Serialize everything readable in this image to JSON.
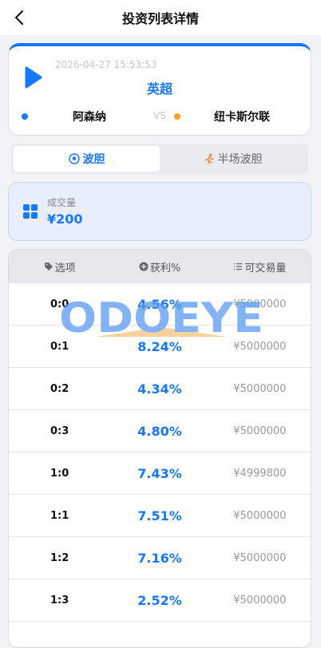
{
  "header": {
    "title": "投资列表详情"
  },
  "match": {
    "time": "2026-04-27 15:53:53",
    "league": "英超",
    "home_team": "阿森纳",
    "vs": "VS",
    "away_team": "纽卡斯尔联"
  },
  "tabs": [
    {
      "label": "波胆",
      "icon": "soccer-ball-icon",
      "active": true
    },
    {
      "label": "半场波胆",
      "icon": "runner-icon",
      "active": false
    }
  ],
  "volume": {
    "label": "成交量",
    "value": "¥200"
  },
  "table": {
    "headers": [
      {
        "label": "选项",
        "icon": "tag-icon"
      },
      {
        "label": "获利%",
        "icon": "plus-circle-icon"
      },
      {
        "label": "可交易量",
        "icon": "list-icon"
      }
    ],
    "rows": [
      {
        "option": "0:0",
        "profit": "4.56%",
        "volume": "¥5000000"
      },
      {
        "option": "0:1",
        "profit": "8.24%",
        "volume": "¥5000000"
      },
      {
        "option": "0:2",
        "profit": "4.34%",
        "volume": "¥5000000"
      },
      {
        "option": "0:3",
        "profit": "4.80%",
        "volume": "¥5000000"
      },
      {
        "option": "1:0",
        "profit": "7.43%",
        "volume": "¥4999800"
      },
      {
        "option": "1:1",
        "profit": "7.51%",
        "volume": "¥5000000"
      },
      {
        "option": "1:2",
        "profit": "7.16%",
        "volume": "¥5000000"
      },
      {
        "option": "1:3",
        "profit": "2.52%",
        "volume": "¥5000000"
      },
      {
        "option": "",
        "profit": "",
        "volume": ""
      }
    ]
  },
  "watermark": {
    "text": "ODOEYE"
  },
  "colors": {
    "accent": "#1677ff",
    "away_dot": "#f7a21c"
  }
}
